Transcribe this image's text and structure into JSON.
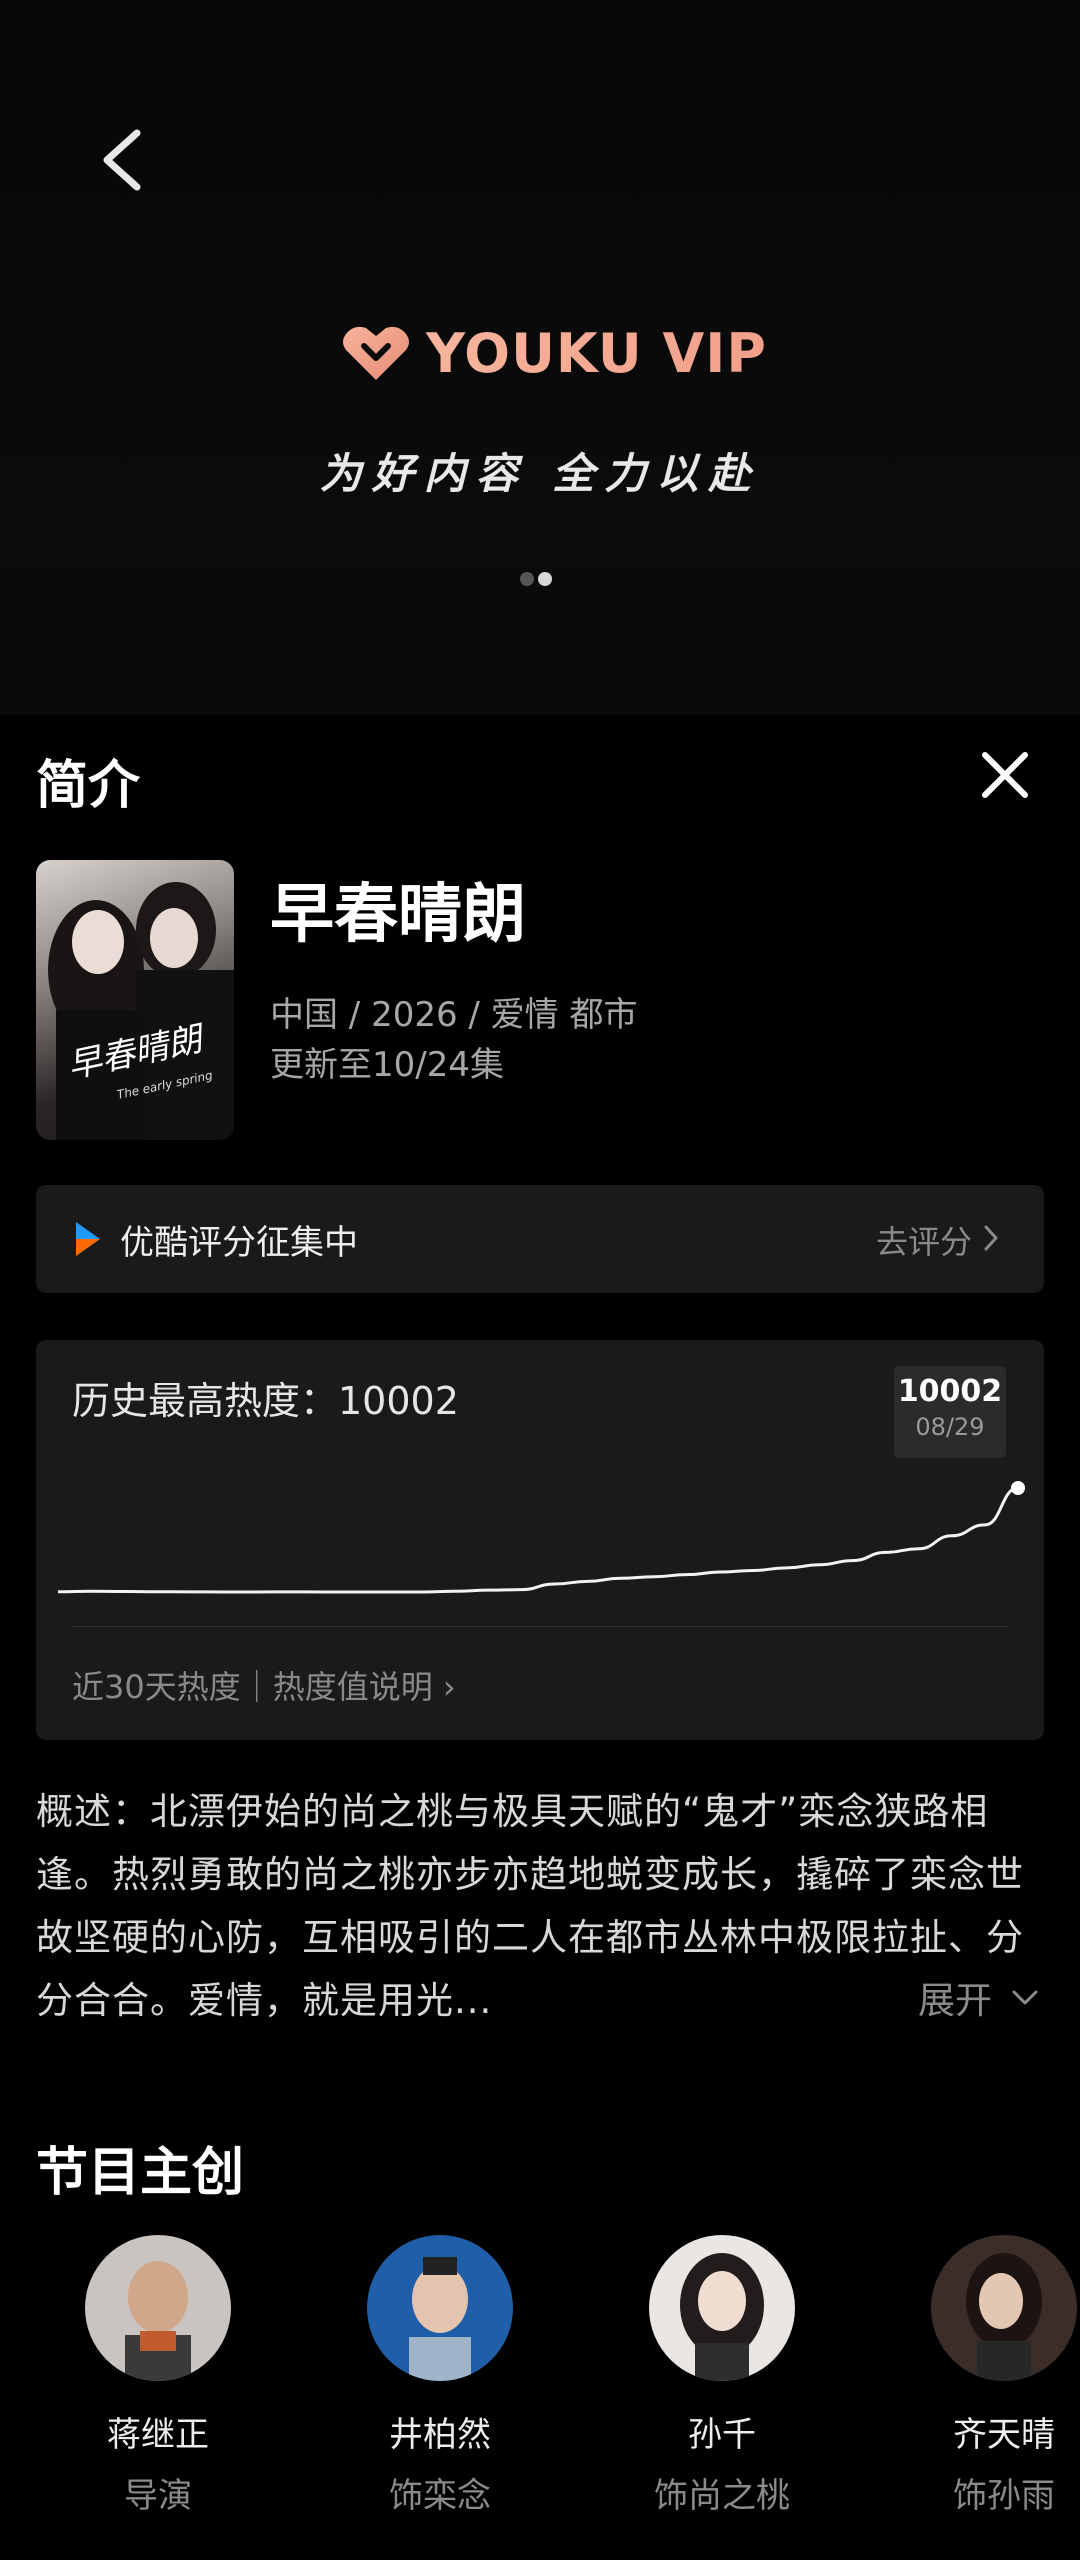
{
  "banner": {
    "brand": "YOUKU VIP",
    "slogan": "为好内容 全力以赴",
    "brand_color": "#f2a08a"
  },
  "panel": {
    "title": "简介"
  },
  "show": {
    "poster_title": "早春晴朗",
    "poster_subtitle": "The early spring",
    "title": "早春晴朗",
    "meta": "中国 / 2026 / 爱情 都市",
    "episodes": "更新至10/24集"
  },
  "rating": {
    "label": "优酷评分征集中",
    "action": "去评分",
    "icon_colors": [
      "#1e9bff",
      "#ff6a00"
    ]
  },
  "heat": {
    "label": "历史最高热度：10002",
    "badge_value": "10002",
    "badge_date": "08/29",
    "footer": "近30天热度｜热度值说明 ›",
    "chart_data": {
      "type": "line",
      "title": "",
      "values": [
        8000,
        8010,
        8005,
        8000,
        7998,
        7996,
        7996,
        7998,
        7996,
        7995,
        7995,
        7996,
        8010,
        8030,
        8040,
        8150,
        8200,
        8260,
        8290,
        8330,
        8380,
        8410,
        8460,
        8520,
        8600,
        8760,
        8830,
        9080,
        9290,
        10002
      ],
      "highlight_last": true
    }
  },
  "synopsis": {
    "text": "概述：北漂伊始的尚之桃与极具天赋的“鬼才”栾念狭路相逢。热烈勇敢的尚之桃亦步亦趋地蜕变成长，撬碎了栾念世故坚硬的心防，互相吸引的二人在都市丛林中极限拉扯、分分合合。爱情，就是用光...",
    "expand": "展开"
  },
  "crew": {
    "title": "节目主创",
    "members": [
      {
        "name": "蒋继正",
        "role": "导演"
      },
      {
        "name": "井柏然",
        "role": "饰栾念"
      },
      {
        "name": "孙千",
        "role": "饰尚之桃"
      },
      {
        "name": "齐天晴",
        "role": "饰孙雨"
      }
    ]
  }
}
